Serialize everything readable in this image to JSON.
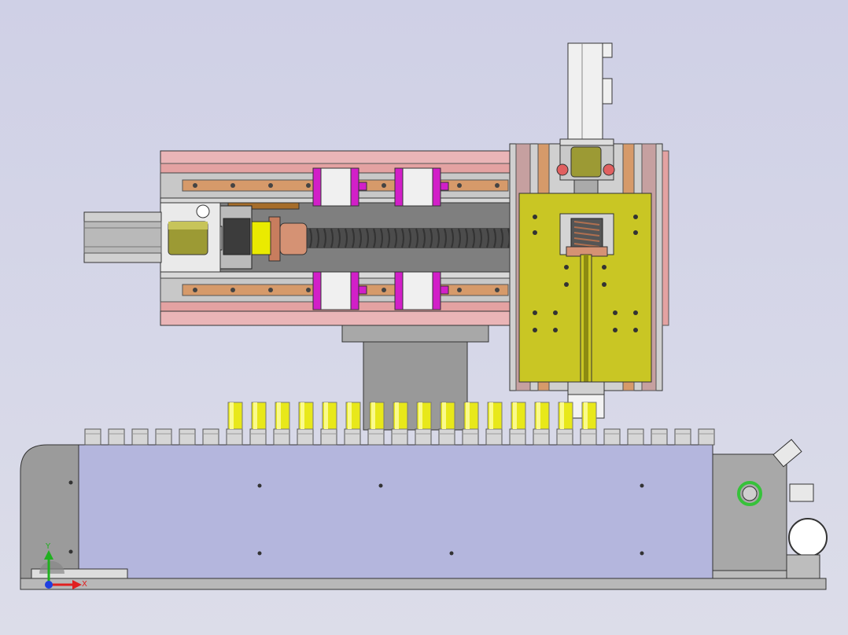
{
  "view": {
    "background": "#d3d4e6",
    "triad": {
      "x_label": "X",
      "y_label": "Y",
      "x_color": "#e02020",
      "y_color": "#20b020",
      "z_color": "#2040e0"
    }
  },
  "colors": {
    "rail_pink": "#e4a2a2",
    "rail_copper": "#d69a6a",
    "slider_magenta": "#d21fc8",
    "carriage_yellow": "#c9c624",
    "ballscrew": "#505050",
    "coupling_olive": "#9c9a34",
    "nut_copper": "#cd8a6c",
    "collar_yellow": "#e6e600",
    "frame_grey": "#8e8e8e",
    "conveyor_body": "#b4b6dd",
    "cup_yellow": "#e8e81a",
    "cup_white": "#d6d6d6",
    "sensor_green": "#36c23a"
  },
  "components": [
    "linear-module-base",
    "ball-screw",
    "servo-motor-horizontal",
    "servo-motor-vertical",
    "z-axis-carriage",
    "linear-guide-sliders",
    "support-column",
    "conveyor-chain",
    "conveyor-frame",
    "drive-sprocket-housing"
  ]
}
